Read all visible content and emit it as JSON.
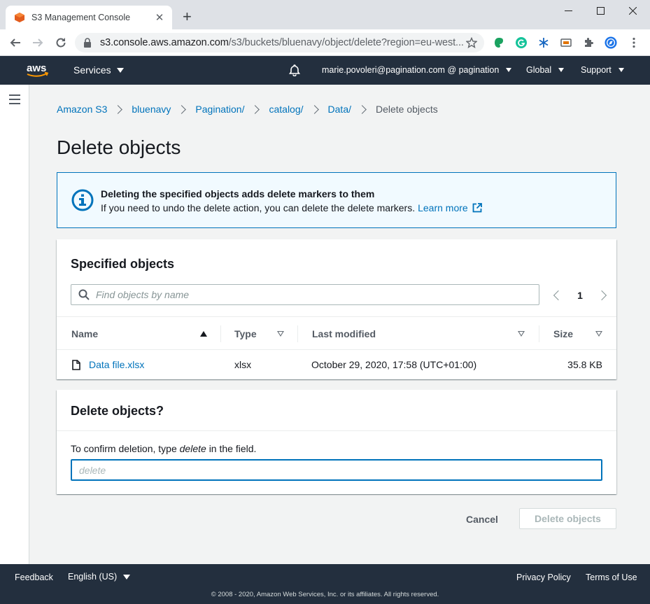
{
  "browser": {
    "tab_title": "S3 Management Console",
    "url_host": "s3.console.aws.amazon.com",
    "url_path": "/s3/buckets/bluenavy/object/delete?region=eu-west..."
  },
  "aws_nav": {
    "services": "Services",
    "account": "marie.povoleri@pagination.com @ pagination",
    "region": "Global",
    "support": "Support"
  },
  "breadcrumb": {
    "items": [
      "Amazon S3",
      "bluenavy",
      "Pagination/",
      "catalog/",
      "Data/"
    ],
    "current": "Delete objects"
  },
  "page_title": "Delete objects",
  "alert": {
    "heading": "Deleting the specified objects adds delete markers to them",
    "body": "If you need to undo the delete action, you can delete the delete markers.",
    "link": "Learn more"
  },
  "objects_panel": {
    "heading": "Specified objects",
    "search_placeholder": "Find objects by name",
    "page": "1",
    "columns": [
      "Name",
      "Type",
      "Last modified",
      "Size"
    ],
    "rows": [
      {
        "name": "Data file.xlsx",
        "type": "xlsx",
        "last_modified": "October 29, 2020, 17:58 (UTC+01:00)",
        "size": "35.8 KB"
      }
    ]
  },
  "confirm_panel": {
    "heading": "Delete objects?",
    "instruction_pre": "To confirm deletion, type",
    "instruction_word": "delete",
    "instruction_post": "in the field.",
    "input_placeholder": "delete",
    "input_value": ""
  },
  "actions": {
    "cancel": "Cancel",
    "delete": "Delete objects"
  },
  "footer": {
    "feedback": "Feedback",
    "language": "English (US)",
    "privacy": "Privacy Policy",
    "terms": "Terms of Use",
    "copyright": "© 2008 - 2020, Amazon Web Services, Inc. or its affiliates. All rights reserved."
  },
  "colors": {
    "aws_nav": "#232f3e",
    "link": "#0073bb",
    "alert_bg": "#f1faff",
    "aws_orange": "#ff9900"
  }
}
